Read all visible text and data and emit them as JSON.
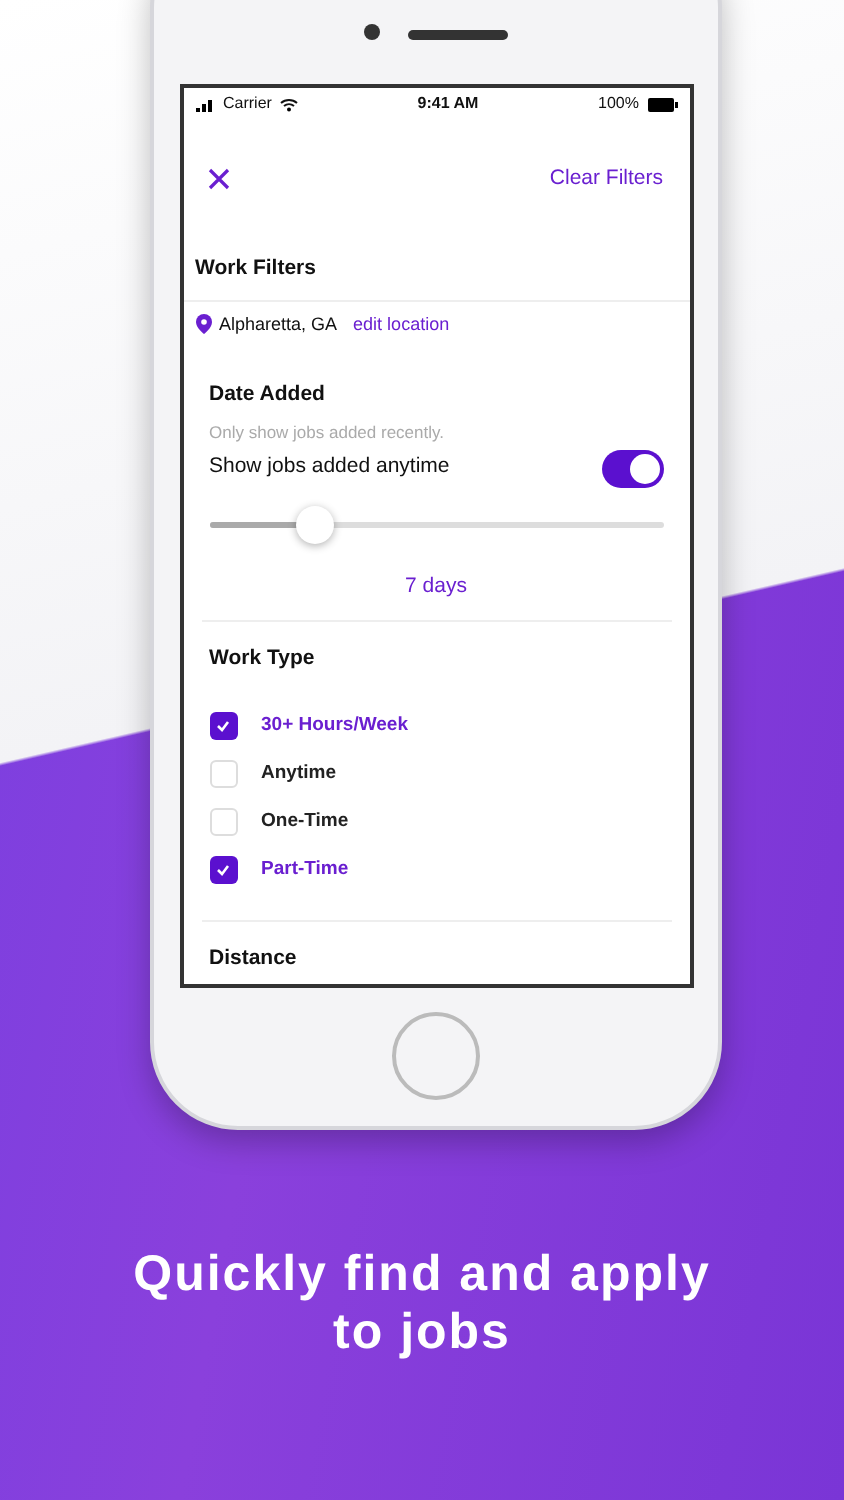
{
  "status_bar": {
    "carrier": "Carrier",
    "time": "9:41 AM",
    "battery": "100%"
  },
  "header": {
    "action": "Clear Filters"
  },
  "title": "Work Filters",
  "location": {
    "place": "Alpharetta, GA",
    "link": "edit location"
  },
  "date_added": {
    "heading": "Date Added",
    "hint": "Only show jobs added recently.",
    "toggle_label": "Show jobs added anytime",
    "on": true,
    "level": 0.23,
    "reading": "7 days"
  },
  "work_type": {
    "heading": "Work Type",
    "options": [
      {
        "label": "30+ Hours/Week",
        "checked": true
      },
      {
        "label": "Anytime",
        "checked": false
      },
      {
        "label": "One-Time",
        "checked": false
      },
      {
        "label": "Part-Time",
        "checked": true
      }
    ]
  },
  "distance": {
    "heading": "Distance"
  },
  "caption": "Quickly find and apply to jobs"
}
